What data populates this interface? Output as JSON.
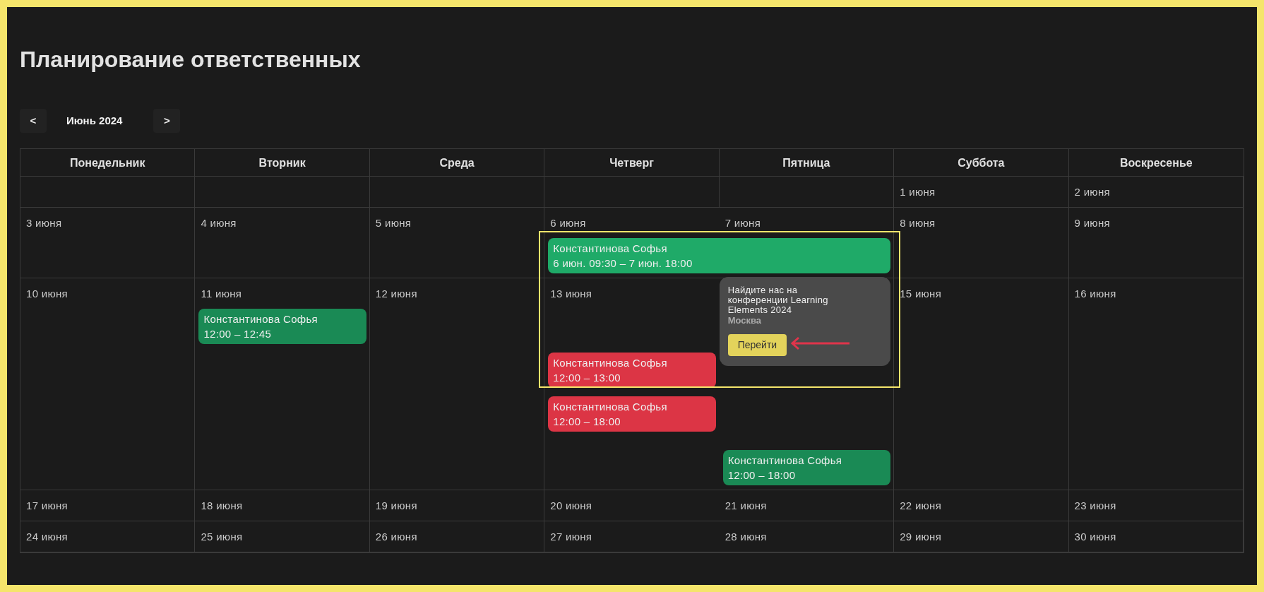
{
  "page": {
    "title": "Планирование ответственных"
  },
  "month_nav": {
    "prev": "<",
    "month": "Июнь 2024",
    "next": ">"
  },
  "weekdays": [
    "Понедельник",
    "Вторник",
    "Среда",
    "Четверг",
    "Пятница",
    "Суббота",
    "Воскресенье"
  ],
  "weeks": [
    {
      "days": [
        {
          "date": "1 июня"
        },
        {
          "date": "2 июня"
        }
      ]
    },
    {
      "days": [
        {
          "date": "3 июня"
        },
        {
          "date": "4 июня"
        },
        {
          "date": "5 июня"
        },
        {
          "date": "6 июня",
          "events": [
            {
              "kind": "multi_day",
              "title": "Константинова Софья",
              "time": "6 июн. 09:30 – 7 июн. 18:00",
              "color": "#1faa68"
            }
          ]
        },
        {
          "date": "7 июня"
        },
        {
          "date": "8 июня"
        },
        {
          "date": "9 июня"
        }
      ]
    },
    {
      "days": [
        {
          "date": "10 июня"
        },
        {
          "date": "11 июня",
          "events": [
            {
              "kind": "single_day",
              "title": "Константинова Софья",
              "time": "12:00 – 12:45",
              "color": "#1a8a55"
            }
          ]
        },
        {
          "date": "12 июня"
        },
        {
          "date": "13 июня",
          "events": [
            {
              "kind": "single_day",
              "title": "Константинова Софья",
              "time": "12:00 – 13:00",
              "color": "#dc3545"
            },
            {
              "kind": "single_day",
              "title": "Константинова Софья",
              "time": "12:00 – 18:00",
              "color": "#dc3545"
            }
          ]
        },
        {
          "events": [
            {
              "kind": "single_day",
              "title": "Константинова Софья",
              "time": "12:00 – 18:00",
              "color": "#1a8a55"
            }
          ]
        },
        {
          "date": "15 июня"
        },
        {
          "date": "16 июня"
        }
      ]
    },
    {
      "days": [
        {
          "date": "17 июня"
        },
        {
          "date": "18 июня"
        },
        {
          "date": "19 июня"
        },
        {
          "date": "20 июня"
        },
        {
          "date": "21 июня"
        },
        {
          "date": "22 июня"
        },
        {
          "date": "23 июня"
        }
      ]
    },
    {
      "days": [
        {
          "date": "24 июня"
        },
        {
          "date": "25 июня"
        },
        {
          "date": "26 июня"
        },
        {
          "date": "27 июня"
        },
        {
          "date": "28 июня"
        },
        {
          "date": "29 июня"
        },
        {
          "date": "30 июня"
        }
      ]
    }
  ],
  "popover": {
    "title": "Найдите нас на конференции Learning Elements 2024",
    "subtitle": "Москва",
    "button": "Перейти"
  }
}
